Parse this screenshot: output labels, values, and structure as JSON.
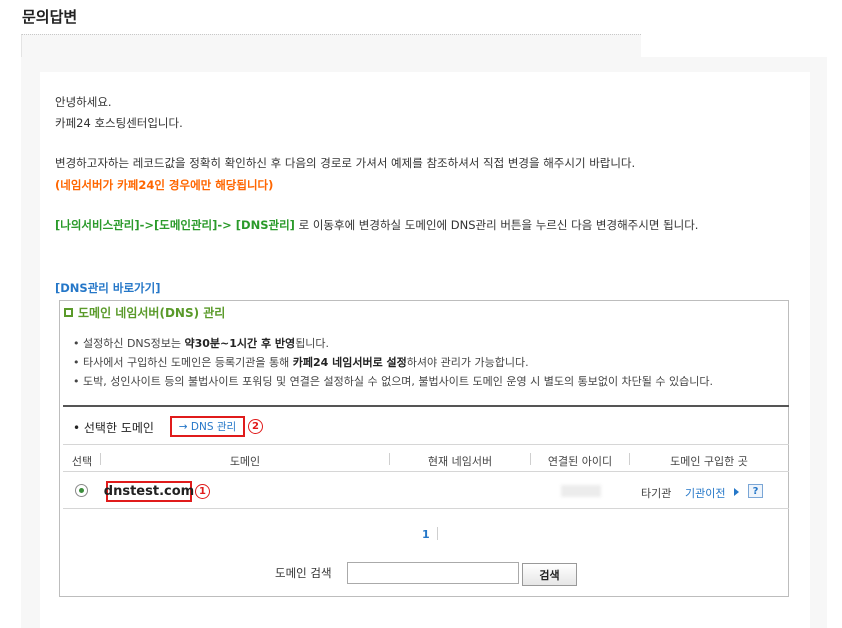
{
  "page_title": "문의답변",
  "greeting": "안녕하세요.",
  "company_line": "카페24 호스팅센터입니다.",
  "instruction_line": "변경하고자하는 레코드값을 정확히 확인하신 후 다음의 경로로 가셔서 예제를 참조하셔서 직접 변경을 해주시기 바랍니다.",
  "note_orange": "(네임서버가 카페24인 경우에만 해당됩니다)",
  "path": {
    "path_green": "[나의서비스관리]->[도메인관리]-> [DNS관리]",
    "path_rest": " 로 이동후에 변경하실 도메인에 DNS관리 버튼을 누르신 다음 변경해주시면 됩니다."
  },
  "dns_shortcut_link": "[DNS관리 바로가기]",
  "box": {
    "title": "도메인 네임서버(DNS) 관리",
    "bullets": [
      {
        "pre": "• 설정하신 DNS정보는 ",
        "bold": "약30분~1시간 후 반영",
        "post": "됩니다."
      },
      {
        "pre": "• 타사에서 구입하신 도메인은 등록기관을 통해 ",
        "bold": "카페24 네임서버로 설정",
        "post": "하셔야 관리가 가능합니다."
      },
      {
        "pre": "• 도박, 성인사이트 등의 불법사이트 포워딩 및 연결은 설정하실 수 없으며, 불법사이트 도메인 운영 시 별도의 통보없이 차단될 수 있습니다.",
        "bold": "",
        "post": ""
      }
    ],
    "selected_label": "• 선택한 도메인",
    "dns_button": "→ DNS 관리",
    "marker_1": "1",
    "marker_2": "2",
    "columns": [
      "선택",
      "도메인",
      "현재 네임서버",
      "연결된 아이디",
      "도메인 구입한 곳"
    ],
    "row": {
      "domain": "dnstest.com",
      "registrar": "타기관",
      "transfer_link": "기관이전",
      "help": "?"
    },
    "page": "1",
    "search_label": "도메인 검색",
    "search_value": "",
    "search_button": "검색"
  }
}
